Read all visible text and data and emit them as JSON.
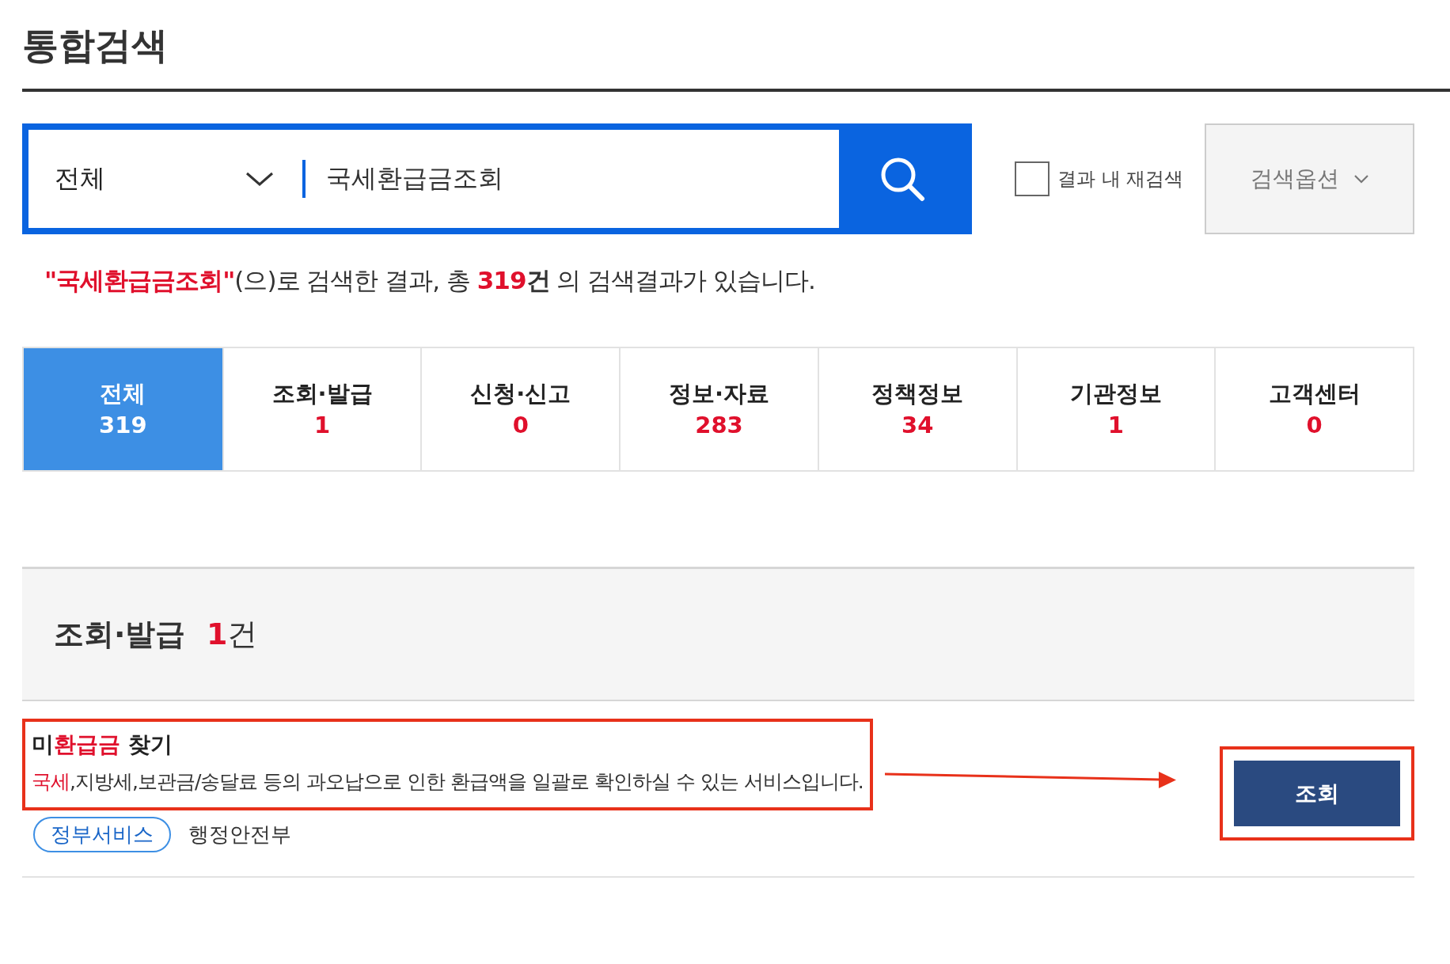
{
  "page_title": "통합검색",
  "search": {
    "scope": "전체",
    "query": "국세환급금조회"
  },
  "refine": {
    "label": "결과 내 재검색",
    "checked": false
  },
  "options_button": "검색옵션",
  "summary": [
    {
      "text": "\"국세환급금조회\"",
      "kind": "highlight"
    },
    {
      "text": "(으)로 검색한 결과, 총 ",
      "kind": "plain"
    },
    {
      "text": "319",
      "kind": "highlight"
    },
    {
      "text": "건",
      "kind": "bold"
    },
    {
      "text": " 의 검색결과가 있습니다.",
      "kind": "plain"
    }
  ],
  "tabs": [
    {
      "label": "전체",
      "count": "319",
      "selected": true
    },
    {
      "label": "조회·발급",
      "count": "1",
      "selected": false
    },
    {
      "label": "신청·신고",
      "count": "0",
      "selected": false
    },
    {
      "label": "정보·자료",
      "count": "283",
      "selected": false
    },
    {
      "label": "정책정보",
      "count": "34",
      "selected": false
    },
    {
      "label": "기관정보",
      "count": "1",
      "selected": false
    },
    {
      "label": "고객센터",
      "count": "0",
      "selected": false
    }
  ],
  "section": {
    "title": "조회·발급",
    "count": "1",
    "unit": "건"
  },
  "results": [
    {
      "title": [
        {
          "text": "미",
          "kind": "plain"
        },
        {
          "text": "환급금",
          "kind": "highlight"
        },
        {
          "text": " 찾기",
          "kind": "plain"
        }
      ],
      "description": [
        {
          "text": "국세",
          "kind": "highlight"
        },
        {
          "text": ",지방세,보관금/송달료 등의 과오납으로 인한 환급액을 일괄로 확인하실 수 있는 서비스입니다.",
          "kind": "plain"
        }
      ],
      "tag": "정부서비스",
      "agency": "행정안전부",
      "button": "조회",
      "annotated": true
    }
  ]
}
